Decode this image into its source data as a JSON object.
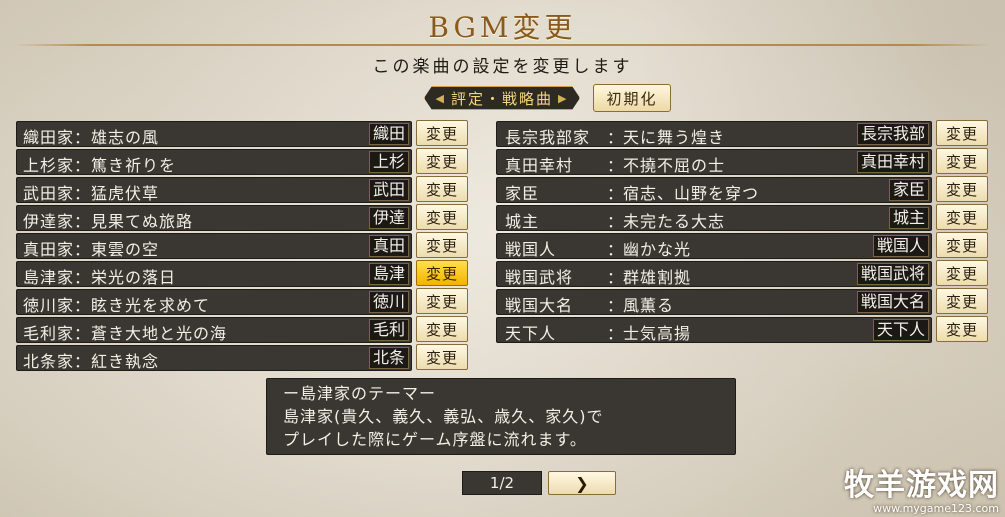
{
  "title": "BGM変更",
  "subtitle": "この楽曲の設定を変更します",
  "category_tab": "評定・戦略曲",
  "reset_label": "初期化",
  "change_label": "変更",
  "left_tracks": [
    {
      "name": "織田家：雄志の風",
      "tag": "織田"
    },
    {
      "name": "上杉家：篤き祈りを",
      "tag": "上杉"
    },
    {
      "name": "武田家：猛虎伏草",
      "tag": "武田"
    },
    {
      "name": "伊達家：見果てぬ旅路",
      "tag": "伊達"
    },
    {
      "name": "真田家：東雲の空",
      "tag": "真田"
    },
    {
      "name": "島津家：栄光の落日",
      "tag": "島津",
      "selected": true
    },
    {
      "name": "徳川家：眩き光を求めて",
      "tag": "徳川"
    },
    {
      "name": "毛利家：蒼き大地と光の海",
      "tag": "毛利"
    },
    {
      "name": "北条家：紅き執念",
      "tag": "北条"
    }
  ],
  "right_tracks": [
    {
      "label": "長宗我部家",
      "title": "天に舞う煌き",
      "tag": "長宗我部"
    },
    {
      "label": "真田幸村",
      "title": "不撓不屈の士",
      "tag": "真田幸村"
    },
    {
      "label": "家臣",
      "title": "宿志、山野を穿つ",
      "tag": "家臣"
    },
    {
      "label": "城主",
      "title": "未完たる大志",
      "tag": "城主"
    },
    {
      "label": "戦国人",
      "title": "幽かな光",
      "tag": "戦国人"
    },
    {
      "label": "戦国武将",
      "title": "群雄割拠",
      "tag": "戦国武将"
    },
    {
      "label": "戦国大名",
      "title": "風薫る",
      "tag": "戦国大名"
    },
    {
      "label": "天下人",
      "title": "士気高揚",
      "tag": "天下人"
    }
  ],
  "separator": "：",
  "description": [
    "ー島津家のテーマー",
    "島津家(貴久、義久、義弘、歳久、家久)で",
    "プレイした際にゲーム序盤に流れます。"
  ],
  "page": "1/2",
  "icons": {
    "tab_marker": "triangle-marker",
    "next": "chevron-right"
  },
  "accent_color": "#f5c400",
  "watermark": {
    "main": "牧羊游戏网",
    "url": "www.mygame123.com"
  }
}
